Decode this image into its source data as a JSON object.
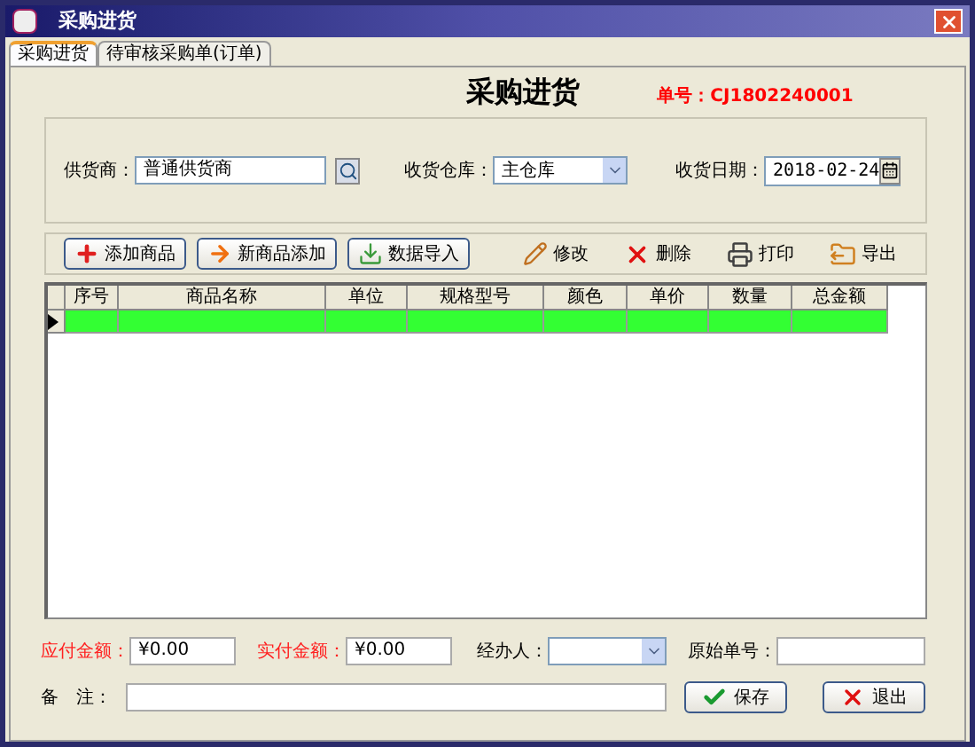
{
  "window": {
    "title": "采购进货"
  },
  "tabs": [
    {
      "label": "采购进货",
      "selected": true
    },
    {
      "label": "待审核采购单(订单)",
      "selected": false
    }
  ],
  "heading": "采购进货",
  "order_number": "单号：CJ1802240001",
  "filters": {
    "supplier": {
      "label": "供货商：",
      "value": "普通供货商"
    },
    "warehouse": {
      "label": "收货仓库：",
      "value": "主仓库"
    },
    "date": {
      "label": "收货日期：",
      "value": "2018-02-24"
    }
  },
  "buttons": [
    {
      "kind": "add",
      "label": "添加商品"
    },
    {
      "kind": "new",
      "label": "新商品添加"
    },
    {
      "kind": "import",
      "label": "数据导入"
    }
  ],
  "actions": [
    {
      "kind": "edit",
      "label": "修改"
    },
    {
      "kind": "delete",
      "label": "删除"
    },
    {
      "kind": "print",
      "label": "打印"
    },
    {
      "kind": "export",
      "label": "导出"
    }
  ],
  "table": {
    "columns": [
      "序号",
      "商品名称",
      "单位",
      "规格型号",
      "颜色",
      "单价",
      "数量",
      "总金额"
    ],
    "rows": [
      {
        "selected": true
      }
    ]
  },
  "footer": {
    "payable": {
      "label": "应付金额：",
      "value": "¥0.00"
    },
    "paid": {
      "label": "实付金额：",
      "value": "¥0.00"
    },
    "handler": {
      "label": "经办人："
    },
    "original_no": {
      "label": "原始单号："
    },
    "remark": {
      "label": "备　注："
    },
    "save": "保存",
    "exit": "退出"
  }
}
